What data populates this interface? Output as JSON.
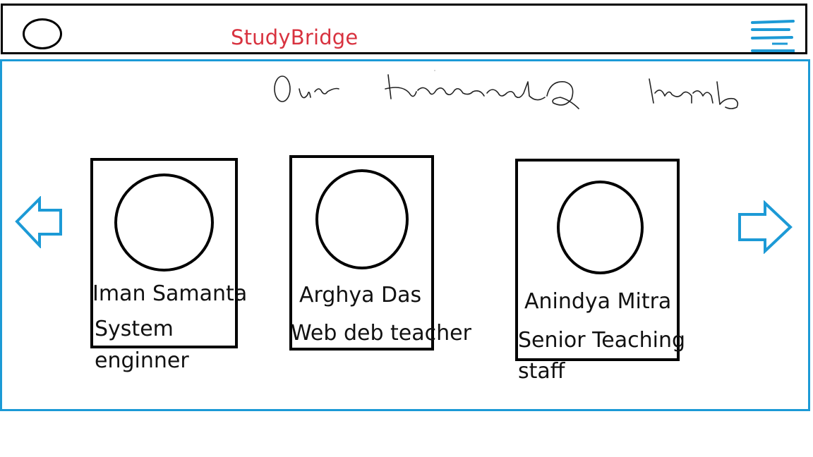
{
  "header": {
    "brand": "StudyBridge",
    "logo_icon": "logo-circle-icon",
    "menu_icon": "hamburger-menu-icon"
  },
  "banner": {
    "handwritten_heading": "Our Honourable Team"
  },
  "carousel": {
    "prev_icon": "arrow-left-icon",
    "next_icon": "arrow-right-icon",
    "members": [
      {
        "name": "Iman Samanta",
        "role_line1": "System",
        "role_line2": "enginner"
      },
      {
        "name": "Arghya Das",
        "role_line1": "Web deb teacher",
        "role_line2": ""
      },
      {
        "name": "Anindya Mitra",
        "role_line1": "Senior Teaching",
        "role_line2": "staff"
      }
    ]
  },
  "colors": {
    "brand": "#d8323f",
    "accent": "#1c9ad6",
    "border": "#000000"
  }
}
